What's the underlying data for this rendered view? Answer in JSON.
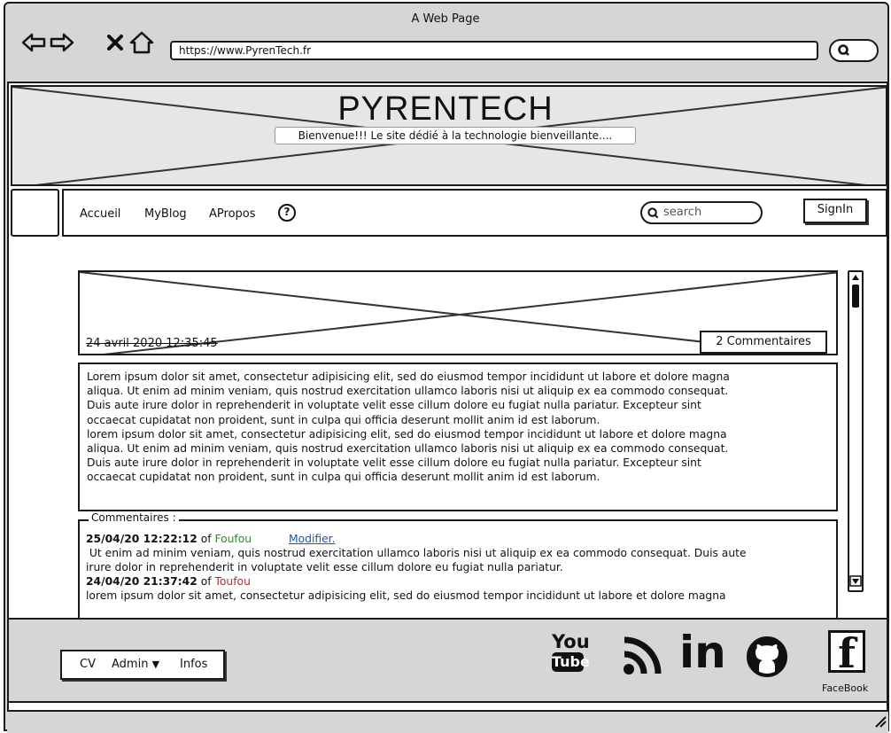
{
  "browser": {
    "window_title": "A Web Page",
    "url": "https://www.PyrenTech.fr"
  },
  "header": {
    "site_title": "PYRENTECH",
    "tagline": "Bienvenue!!! Le site dédié à la technologie bienveillante...."
  },
  "nav": {
    "items": [
      "Accueil",
      "MyBlog",
      "APropos"
    ],
    "help_glyph": "?",
    "search_placeholder": "search",
    "signin_label": "SignIn"
  },
  "post": {
    "date": "24 avril 2020 12:35:45",
    "comments_count_label": "2 Commentaires",
    "body_lines": [
      "Lorem ipsum dolor sit amet, consectetur adipisicing elit, sed do eiusmod tempor incididunt ut labore et dolore magna",
      "aliqua. Ut enim ad minim veniam, quis nostrud exercitation ullamco laboris nisi ut aliquip ex ea commodo consequat.",
      "Duis aute irure dolor in reprehenderit in voluptate velit esse cillum dolore eu fugiat nulla pariatur. Excepteur sint",
      "occaecat cupidatat non proident, sunt in culpa qui officia deserunt mollit anim id est laborum.",
      "lorem ipsum dolor sit amet, consectetur adipisicing elit, sed do eiusmod tempor incididunt ut labore et dolore magna",
      "aliqua. Ut enim ad minim veniam, quis nostrud exercitation ullamco laboris nisi ut aliquip ex ea commodo consequat.",
      "Duis aute irure dolor in reprehenderit in voluptate velit esse cillum dolore eu fugiat nulla pariatur. Excepteur sint",
      "occaecat cupidatat non proident, sunt in culpa qui officia deserunt mollit anim id est laborum."
    ]
  },
  "comments": {
    "legend": "Commentaires :",
    "items": [
      {
        "timestamp": "25/04/20 12:22:12",
        "of": "of",
        "author": "Foufou",
        "author_color": "#2e8b2e",
        "action": "Modifier.",
        "text_lines": [
          " Ut enim ad minim veniam, quis nostrud exercitation ullamco laboris nisi ut aliquip ex ea commodo consequat. Duis aute",
          "irure dolor in reprehenderit in voluptate velit esse cillum dolore eu fugiat nulla pariatur."
        ]
      },
      {
        "timestamp": "24/04/20 21:37:42",
        "of": "of",
        "author": "Toufou",
        "author_color": "#cc2222",
        "text_lines": [
          "lorem ipsum dolor sit amet, consectetur adipisicing elit, sed do eiusmod tempor incididunt ut labore et dolore magna"
        ]
      }
    ]
  },
  "footer": {
    "links": [
      "CV",
      "Admin",
      "Infos"
    ],
    "admin_caret": "▼",
    "social": {
      "youtube_top": "You",
      "youtube_bottom": "Tube",
      "linkedin": "in",
      "facebook_glyph": "f",
      "facebook_label": "FaceBook"
    }
  },
  "colors": {
    "link": "#1a55b0"
  }
}
